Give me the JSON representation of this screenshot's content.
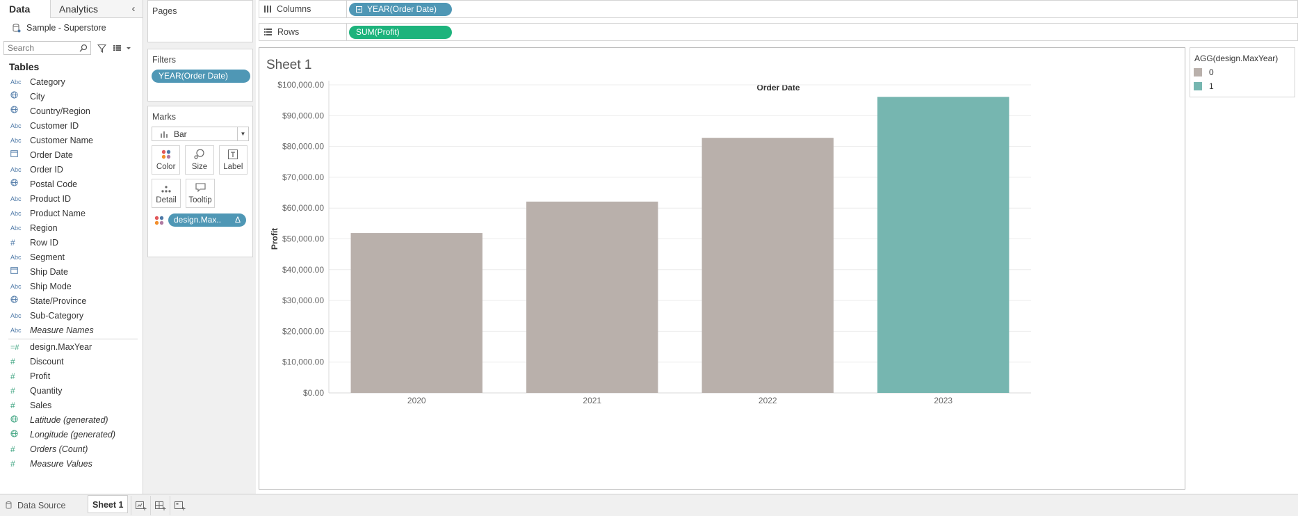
{
  "data_pane": {
    "tabs": [
      "Data",
      "Analytics"
    ],
    "datasource": "Sample - Superstore",
    "search_placeholder": "Search",
    "tables_header": "Tables",
    "dimensions": [
      {
        "icon": "Abc",
        "name": "Category"
      },
      {
        "icon": "globe",
        "name": "City"
      },
      {
        "icon": "globe",
        "name": "Country/Region"
      },
      {
        "icon": "Abc",
        "name": "Customer ID"
      },
      {
        "icon": "Abc",
        "name": "Customer Name"
      },
      {
        "icon": "date",
        "name": "Order Date"
      },
      {
        "icon": "Abc",
        "name": "Order ID"
      },
      {
        "icon": "globe",
        "name": "Postal Code"
      },
      {
        "icon": "Abc",
        "name": "Product ID"
      },
      {
        "icon": "Abc",
        "name": "Product Name"
      },
      {
        "icon": "Abc",
        "name": "Region"
      },
      {
        "icon": "#",
        "name": "Row ID"
      },
      {
        "icon": "Abc",
        "name": "Segment"
      },
      {
        "icon": "date",
        "name": "Ship Date"
      },
      {
        "icon": "Abc",
        "name": "Ship Mode"
      },
      {
        "icon": "globe",
        "name": "State/Province"
      },
      {
        "icon": "Abc",
        "name": "Sub-Category"
      },
      {
        "icon": "Abc",
        "name": "Measure Names",
        "italic": true
      }
    ],
    "measures": [
      {
        "icon": "=#",
        "name": "design.MaxYear"
      },
      {
        "icon": "#",
        "name": "Discount"
      },
      {
        "icon": "#",
        "name": "Profit"
      },
      {
        "icon": "#",
        "name": "Quantity"
      },
      {
        "icon": "#",
        "name": "Sales"
      },
      {
        "icon": "globe",
        "name": "Latitude (generated)",
        "italic": true
      },
      {
        "icon": "globe",
        "name": "Longitude (generated)",
        "italic": true
      },
      {
        "icon": "#",
        "name": "Orders (Count)",
        "italic": true
      },
      {
        "icon": "#",
        "name": "Measure Values",
        "italic": true
      }
    ]
  },
  "cards": {
    "pages_title": "Pages",
    "filters_title": "Filters",
    "filter_pill": "YEAR(Order Date)",
    "marks_title": "Marks",
    "mark_type": "Bar",
    "mark_buttons": [
      "Color",
      "Size",
      "Label",
      "Detail",
      "Tooltip"
    ],
    "color_pill": "design.Max..",
    "color_pill_suffix": "Δ"
  },
  "shelves": {
    "columns_label": "Columns",
    "columns_pill": "YEAR(Order Date)",
    "rows_label": "Rows",
    "rows_pill": "SUM(Profit)"
  },
  "sheet": {
    "title": "Sheet 1",
    "column_header": "Order Date"
  },
  "legend": {
    "title": "AGG(design.MaxYear)",
    "items": [
      {
        "label": "0",
        "color": "#b9b0ab"
      },
      {
        "label": "1",
        "color": "#76b6b0"
      }
    ]
  },
  "chart_data": {
    "type": "bar",
    "categories": [
      "2020",
      "2021",
      "2022",
      "2023"
    ],
    "values": [
      51900,
      62100,
      82800,
      96100
    ],
    "color_group": [
      0,
      0,
      0,
      1
    ],
    "colors": {
      "0": "#b9b0ab",
      "1": "#76b6b0"
    },
    "ylabel": "Profit",
    "xlabel": "Order Date",
    "ylim": [
      0,
      100000
    ],
    "yticks": [
      "$0.00",
      "$10,000.00",
      "$20,000.00",
      "$30,000.00",
      "$40,000.00",
      "$50,000.00",
      "$60,000.00",
      "$70,000.00",
      "$80,000.00",
      "$90,000.00",
      "$100,000.00"
    ],
    "grid": true
  },
  "bottom": {
    "datasource_tab": "Data Source",
    "sheet_tab": "Sheet 1"
  }
}
